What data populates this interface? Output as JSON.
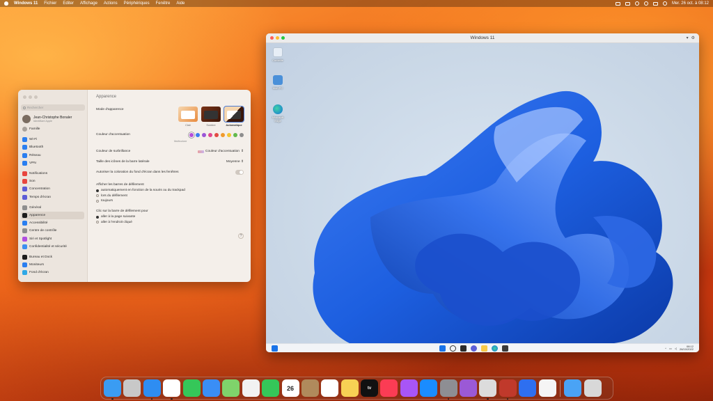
{
  "menubar": {
    "app_name": "Windows 11",
    "items": [
      "Fichier",
      "Editer",
      "Affichage",
      "Actions",
      "Périphériques",
      "Fenêtre",
      "Aide"
    ],
    "clock": "Mer. 26 oct. à 08:12"
  },
  "settings": {
    "search_placeholder": "Rechercher",
    "user_name": "Jean-Christophe Bonaler",
    "user_sub": "Identifiant Apple",
    "family": "Famille",
    "sidebar_groups": [
      [
        "Wi-Fi",
        "Bluetooth",
        "Réseau",
        "VPN"
      ],
      [
        "Notifications",
        "Son",
        "Concentration",
        "Temps d'écran"
      ],
      [
        "Général",
        "Apparence",
        "Accessibilité",
        "Centre de contrôle",
        "Siri et Spotlight",
        "Confidentialité et sécurité"
      ],
      [
        "Bureau et Dock",
        "Moniteurs",
        "Fond d'écran"
      ]
    ],
    "selected_item": "Apparence",
    "pane_title": "Apparence",
    "appearance_label": "Mode d'apparence",
    "appearance_options": [
      "Clair",
      "Sombre",
      "Automatique"
    ],
    "accent_label": "Couleur d'accentuation",
    "accent_sub": "Multicolore",
    "accent_colors": [
      "#b44fd8",
      "#3b7cf0",
      "#9a54d6",
      "#e0498d",
      "#e24b43",
      "#f09a2b",
      "#f3c431",
      "#62b94c",
      "#8e8e8e"
    ],
    "highlight_label": "Couleur de surbrillance",
    "highlight_value": "Couleur d'accentuation",
    "sidebar_icon_label": "Taille des icônes de la barre latérale",
    "sidebar_icon_value": "Moyenne",
    "tinting_label": "Autoriser la coloration du fond d'écran dans les fenêtres",
    "scrollbars_label": "Afficher les barres de défilement",
    "scrollbar_options": [
      "automatiquement en fonction de la souris ou du trackpad",
      "lors du défilement",
      "toujours"
    ],
    "click_label": "Clic sur la barre de défilement pour",
    "click_options": [
      "aller à la page suivante",
      "aller à l'endroit cliqué"
    ],
    "help": "?"
  },
  "vm": {
    "title": "Windows 11",
    "desktop_icons": [
      "Corbeille",
      "Mon PC",
      "Microsoft Edge"
    ],
    "time": "08:12",
    "date": "26/10/2022"
  },
  "dock": {
    "apps": [
      "Finder",
      "Launchpad",
      "Safari",
      "Chrome",
      "Messages",
      "Mail",
      "Plans",
      "Photos",
      "FaceTime",
      "Calendrier",
      "Contacts",
      "Rappels",
      "Notes",
      "TV",
      "Musique",
      "Podcasts",
      "App Store",
      "Réglages Système",
      "Feedback",
      "Parallels",
      "Windows 11",
      "Applications Windows",
      "TextEdit",
      "Téléchargements",
      "Corbeille"
    ],
    "calendar_day": "26",
    "tv_label": "tv"
  }
}
